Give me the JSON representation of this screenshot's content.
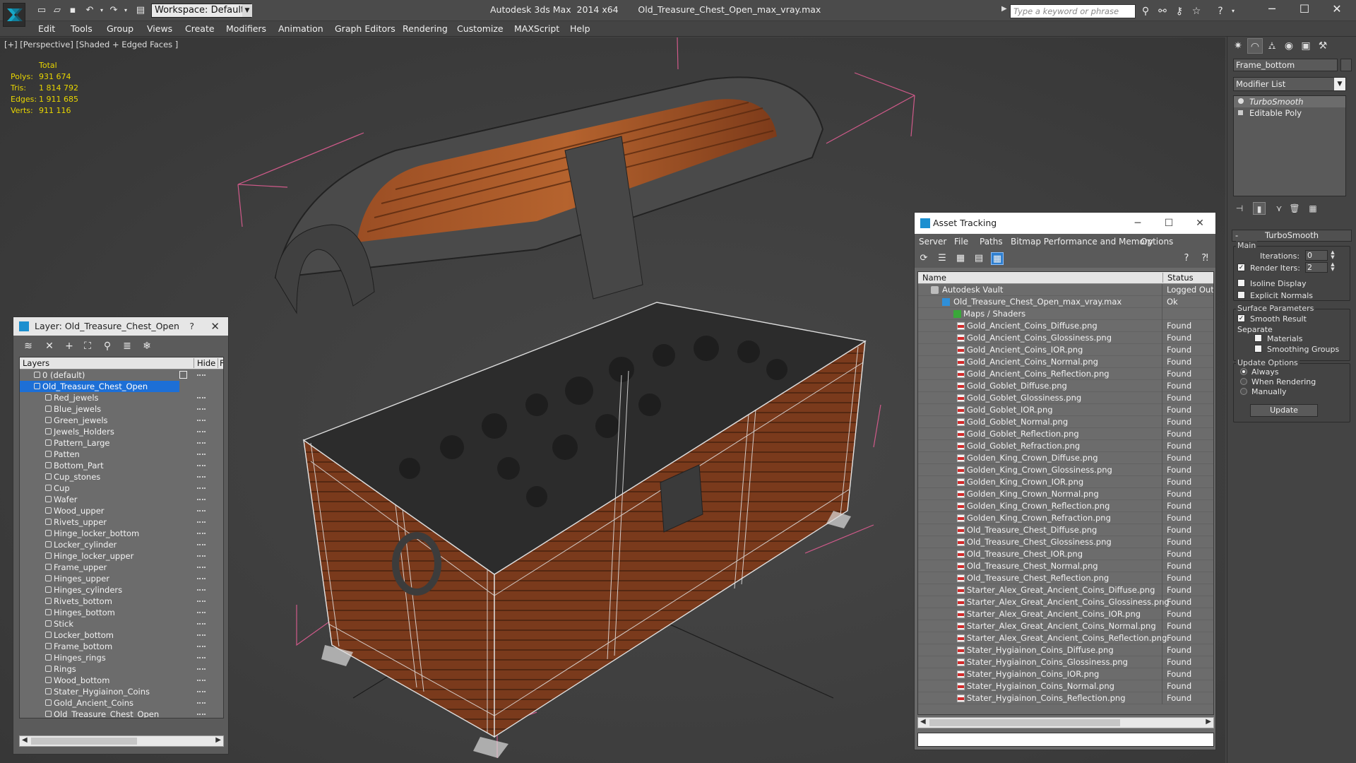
{
  "titlebar": {
    "app_title": "Autodesk 3ds Max  2014 x64       Old_Treasure_Chest_Open_max_vray.max",
    "workspace": "Workspace: Default",
    "search_placeholder": "Type a keyword or phrase"
  },
  "menu": [
    "Edit",
    "Tools",
    "Group",
    "Views",
    "Create",
    "Modifiers",
    "Animation",
    "Graph Editors",
    "Rendering",
    "Customize",
    "MAXScript",
    "Help"
  ],
  "viewport": {
    "label": "[+] [Perspective] [Shaded + Edged Faces ]",
    "stats_header": "Total",
    "stats": [
      {
        "label": "Polys:",
        "value": "931 674"
      },
      {
        "label": "Tris:",
        "value": "1 814 792"
      },
      {
        "label": "Edges:",
        "value": "1 911 685"
      },
      {
        "label": "Verts:",
        "value": "911 116"
      }
    ]
  },
  "layer_panel": {
    "title": "Layer: Old_Treasure_Chest_Open",
    "help": "?",
    "col_layers": "Layers",
    "col_hide": "Hide",
    "col_f": "F",
    "top_layers": [
      {
        "name": "0 (default)"
      },
      {
        "name": "Old_Treasure_Chest_Open"
      }
    ],
    "objects": [
      "Red_jewels",
      "Blue_jewels",
      "Green_jewels",
      "Jewels_Holders",
      "Pattern_Large",
      "Patten",
      "Bottom_Part",
      "Cup_stones",
      "Cup",
      "Wafer",
      "Wood_upper",
      "Rivets_upper",
      "Hinge_locker_bottom",
      "Locker_cylinder",
      "Hinge_locker_upper",
      "Frame_upper",
      "Hinges_upper",
      "Hinges_cylinders",
      "Rivets_bottom",
      "Hinges_bottom",
      "Stick",
      "Locker_bottom",
      "Frame_bottom",
      "Hinges_rings",
      "Rings",
      "Wood_bottom",
      "Stater_Hygiainon_Coins",
      "Gold_Ancient_Coins",
      "Old_Treasure_Chest_Open"
    ]
  },
  "asset_panel": {
    "title": "Asset Tracking",
    "menu": [
      "Server",
      "File",
      "Paths",
      "Bitmap Performance and Memory",
      "Options"
    ],
    "col_name": "Name",
    "col_status": "Status",
    "vault": {
      "name": "Autodesk Vault",
      "status": "Logged Out"
    },
    "file": {
      "name": "Old_Treasure_Chest_Open_max_vray.max",
      "status": "Ok"
    },
    "maps_group": "Maps / Shaders",
    "maps": [
      {
        "name": "Gold_Ancient_Coins_Diffuse.png",
        "status": "Found"
      },
      {
        "name": "Gold_Ancient_Coins_Glossiness.png",
        "status": "Found"
      },
      {
        "name": "Gold_Ancient_Coins_IOR.png",
        "status": "Found"
      },
      {
        "name": "Gold_Ancient_Coins_Normal.png",
        "status": "Found"
      },
      {
        "name": "Gold_Ancient_Coins_Reflection.png",
        "status": "Found"
      },
      {
        "name": "Gold_Goblet_Diffuse.png",
        "status": "Found"
      },
      {
        "name": "Gold_Goblet_Glossiness.png",
        "status": "Found"
      },
      {
        "name": "Gold_Goblet_IOR.png",
        "status": "Found"
      },
      {
        "name": "Gold_Goblet_Normal.png",
        "status": "Found"
      },
      {
        "name": "Gold_Goblet_Reflection.png",
        "status": "Found"
      },
      {
        "name": "Gold_Goblet_Refraction.png",
        "status": "Found"
      },
      {
        "name": "Golden_King_Crown_Diffuse.png",
        "status": "Found"
      },
      {
        "name": "Golden_King_Crown_Glossiness.png",
        "status": "Found"
      },
      {
        "name": "Golden_King_Crown_IOR.png",
        "status": "Found"
      },
      {
        "name": "Golden_King_Crown_Normal.png",
        "status": "Found"
      },
      {
        "name": "Golden_King_Crown_Reflection.png",
        "status": "Found"
      },
      {
        "name": "Golden_King_Crown_Refraction.png",
        "status": "Found"
      },
      {
        "name": "Old_Treasure_Chest_Diffuse.png",
        "status": "Found"
      },
      {
        "name": "Old_Treasure_Chest_Glossiness.png",
        "status": "Found"
      },
      {
        "name": "Old_Treasure_Chest_IOR.png",
        "status": "Found"
      },
      {
        "name": "Old_Treasure_Chest_Normal.png",
        "status": "Found"
      },
      {
        "name": "Old_Treasure_Chest_Reflection.png",
        "status": "Found"
      },
      {
        "name": "Starter_Alex_Great_Ancient_Coins_Diffuse.png",
        "status": "Found"
      },
      {
        "name": "Starter_Alex_Great_Ancient_Coins_Glossiness.png",
        "status": "Found"
      },
      {
        "name": "Starter_Alex_Great_Ancient_Coins_IOR.png",
        "status": "Found"
      },
      {
        "name": "Starter_Alex_Great_Ancient_Coins_Normal.png",
        "status": "Found"
      },
      {
        "name": "Starter_Alex_Great_Ancient_Coins_Reflection.png",
        "status": "Found"
      },
      {
        "name": "Stater_Hygiainon_Coins_Diffuse.png",
        "status": "Found"
      },
      {
        "name": "Stater_Hygiainon_Coins_Glossiness.png",
        "status": "Found"
      },
      {
        "name": "Stater_Hygiainon_Coins_IOR.png",
        "status": "Found"
      },
      {
        "name": "Stater_Hygiainon_Coins_Normal.png",
        "status": "Found"
      },
      {
        "name": "Stater_Hygiainon_Coins_Reflection.png",
        "status": "Found"
      }
    ]
  },
  "command_panel": {
    "object_name": "Frame_bottom",
    "modifier_list": "Modifier List",
    "stack": [
      "TurboSmooth",
      "Editable Poly"
    ],
    "rollout_title": "TurboSmooth",
    "main_group": "Main",
    "iterations_label": "Iterations:",
    "iterations_value": "0",
    "render_iters_label": "Render Iters:",
    "render_iters_value": "2",
    "render_iters_checked": true,
    "isoline_label": "Isoline Display",
    "explicit_normals_label": "Explicit Normals",
    "surface_group": "Surface Parameters",
    "smooth_result_label": "Smooth Result",
    "separate_label": "Separate",
    "materials_label": "Materials",
    "smoothing_groups_label": "Smoothing Groups",
    "update_group": "Update Options",
    "always_label": "Always",
    "when_rendering_label": "When Rendering",
    "manually_label": "Manually",
    "update_button": "Update"
  },
  "colors": {
    "selection_blue": "#1d6fd6",
    "stats_yellow": "#e8d500",
    "bbox_pink": "#d05a8a",
    "wood": "#7a3a1c"
  }
}
